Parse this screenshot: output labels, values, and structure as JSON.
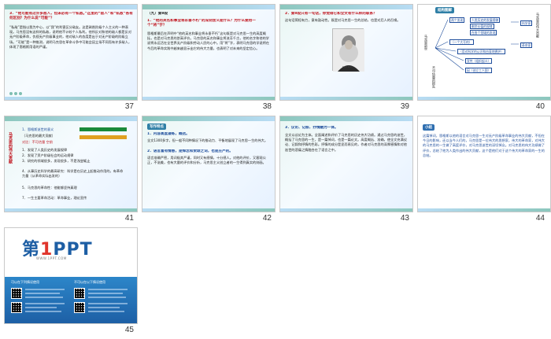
{
  "slides": [
    {
      "number": "37",
      "heading": "3．“他可能有过许多敌人，但未必有一个私敌。”这里的“敌人”和“私敌”各有何区别？为什么说“可能”？",
      "body": "“私敌”是指以我为中心，以“我”的利害区分敌友。这是剥削阶级个人主义的一种表现。马克思没有这样的私敌，说明他不计较个人私利。他所反对和他的敌人都是反对无产阶级革命，仇视无产阶级事业的，他对敌人的态度是出于对无产阶级的阶级立场。“可能”是一种推测，说明马克思在革命斗争中可能会因立场不同而有许多敌人，体现了恩格斯用语的严谨。"
    },
    {
      "number": "38",
      "tag": "（九）第9段",
      "heading": "1．“他的英名和事业将永垂不朽”的深刻含义是什么？为什么要用一个“将”字？",
      "body": "恩格斯最后在声明中“他的英名和事业将永垂不朽”这句既是对马克思一生的高度概括，也是对马克思的崇高评价。马克思的英名和事业将流芳千古，他的名字和他的学说将永远活在全世界无产阶级和劳动人民的心中。用“将”字，表明马克思的学说将在今后的革命实践中越来越显示出它的伟大力量，也表明了对未来的坚定信心。"
    },
    {
      "number": "39",
      "heading": "2．第9段只有一句话，你觉得它和全文有什么样的联系？",
      "body": "这句话简短有力，意有鼓动性。既是对马克思一生的总结，也是对后人的召唤。",
      "caption": "Karl Marx"
    },
    {
      "number": "40",
      "tag": "结构图解",
      "boxes": [
        "马克思逝世",
        "两个发现",
        "人类历史的发展规律",
        "剩余价值的规律",
        "在各个领域的发现",
        "科学家",
        "革命家",
        "（一个大写的）",
        "（用对科学的认识和由衷地拥护）",
        "宣传（组织起义）",
        "革命家",
        "在那里（一个一）",
        "大",
        "宣传（组织起义）",
        "第一：（不可估量的损失）",
        "因（创立工人国）"
      ],
      "side_labels": [
        "马克思逝世",
        "不可估量的损失",
        "共产主义运动中的领袖",
        "马克思的伟大贡献"
      ]
    },
    {
      "number": "41",
      "heading": "第四至第五段的对比描写：",
      "items": [
        "1．恩格斯逝世的意义",
        "2．（全部资料）（三段式）",
        "（马克思的最大贡献）",
        "对比：不可估量 空前",
        "1．发现了人类历史的发展规律",
        "2．发现了资产阶级社会的运动规律",
        "3．研究的领域很多，发现很多，不是浅尝辄止",
        "4．从事历史科学的最高研究：科学是在历史上起推动作用的，有革命力量（从革命实际出发的）",
        "5．马克思的革命性：他能够坚持真理",
        "7．一生主要革命活动：革命事业，理论宣传"
      ],
      "vertical": "马克思的伟大贡献"
    },
    {
      "number": "42",
      "tag": "写作特点",
      "lines": [
        "1．内容高度凝练，概括。",
        "全文1300多字，但一般不同种情况下的推动力、平衡地展现了马克思一生的伟大。",
        "2．语言富有情感，是悼念和赞颂之词，也是庄严的。",
        "语言准确严密，用词极其严谨，同时又有感情，十分感人。对他的评价，又客观公正，不溢美，也有大量的评价和分析，马克思主义创立者的一生得到真实的刻画。"
      ]
    },
    {
      "number": "43",
      "heading": "3．议论、记叙、抒情融为一体。",
      "body": "全文以议论为主体。全面阐述和评价了马克思的历史伟大功绩。通过马克思的逝世，概括了马克思的一生，是一篇悼词，也是一篇论文。高度概括、准确，使全文充满议论、记叙和抒情的色彩。抒情的成分是显而易见的，作者对马克思的深厚感情和对他逝世的悲痛之情融合在了语言之中。"
    },
    {
      "number": "44",
      "tag": "小结",
      "body": "这篇悼词，恩格斯以他的语言对马克思一生对无产阶级革命事业的伟大贡献，不但在今日的影响，还以当今人们的，马克思是一位伟大的思想家，伟大的革命家，对伟大的马克思的一生做了高度评价，对马克思逝世的深切悼念。对马克思的伟大功绩做了评价，总结了他为人类作出的伟大贡献，这个是他们对于这个伟大的革命家的一生的总结。"
    },
    {
      "number": "45",
      "logo_prefix": "第",
      "logo_one": "1",
      "logo_suffix": "PPT",
      "logo_sub": "WWW.1PPT.COM",
      "left_col": "可以在下列情况使用",
      "right_col": "不可以在以下情况使用"
    }
  ]
}
